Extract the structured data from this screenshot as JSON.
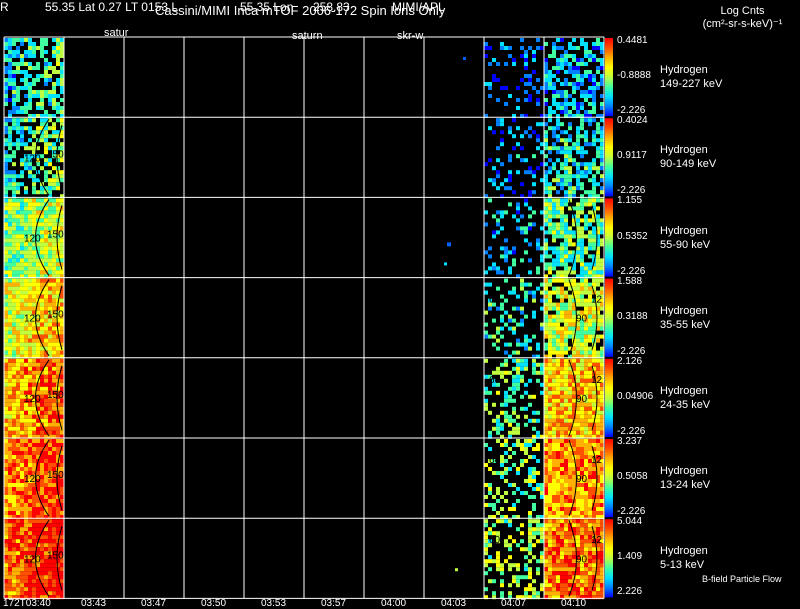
{
  "header": {
    "title": "Cassini/MIMI Inca mTOF  2006-172   Spin    Ions Only",
    "subtitle_parts": [
      "R",
      "55.35 Lat 0.27 LT 0153 L",
      "55.35 Lon",
      "258.83",
      "MIMI/APL"
    ],
    "overlay_labels": [
      "satur",
      "saturn",
      "skr-w"
    ],
    "units_line1": "Log Cnts",
    "units_line2": "(cm²-sr-s-keV)⁻¹"
  },
  "legend_note": "B-field Particle Flow",
  "colors": {
    "background": "#000000",
    "grid": "#ffffff",
    "text": "#ffffff"
  },
  "chart_data": {
    "type": "heatmap",
    "title": "Cassini/MIMI Inca mTOF  2006-172   Spin    Ions Only",
    "x_tick_labels": [
      "172T03:40",
      "03:43",
      "03:47",
      "03:50",
      "03:53",
      "03:57",
      "04:00",
      "04:03",
      "04:07",
      "04:10"
    ],
    "pitch_angle_labels": [
      "120",
      "150",
      "60",
      "90",
      "12"
    ],
    "colormap": [
      "#0000ff",
      "#0080ff",
      "#00e0ff",
      "#40ffa0",
      "#c0ff40",
      "#ffff00",
      "#ffb000",
      "#ff5000",
      "#ff0000"
    ],
    "panels": [
      {
        "species": "Hydrogen",
        "energy": "149-227 keV",
        "cmax": "0.4481",
        "cmid": "-0.8888",
        "cmin": "-2.226",
        "level": 0.25
      },
      {
        "species": "Hydrogen",
        "energy": "90-149 keV",
        "cmax": "0.4024",
        "cmid": "0.9117",
        "cmin": "-2.226",
        "level": 0.3
      },
      {
        "species": "Hydrogen",
        "energy": "55-90 keV",
        "cmax": "1.155",
        "cmid": "0.5352",
        "cmin": "-2.226",
        "level": 0.42
      },
      {
        "species": "Hydrogen",
        "energy": "35-55 keV",
        "cmax": "1.588",
        "cmid": "0.3188",
        "cmin": "-2.226",
        "level": 0.55
      },
      {
        "species": "Hydrogen",
        "energy": "24-35 keV",
        "cmax": "2.126",
        "cmid": "0.04906",
        "cmin": "-2.226",
        "level": 0.68
      },
      {
        "species": "Hydrogen",
        "energy": "13-24 keV",
        "cmax": "3.237",
        "cmid": "0.5058",
        "cmin": "-2.226",
        "level": 0.75
      },
      {
        "species": "Hydrogen",
        "energy": "5-13 keV",
        "cmax": "5.044",
        "cmid": "1.409",
        "cmin": "2.226",
        "level": 0.8
      }
    ]
  }
}
